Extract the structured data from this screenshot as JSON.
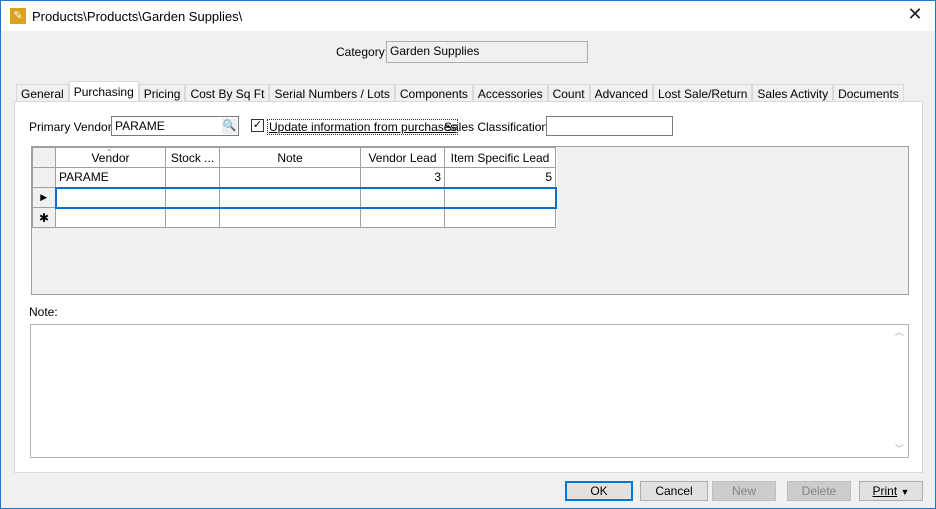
{
  "window": {
    "title": "Products\\Products\\Garden Supplies\\"
  },
  "category": {
    "label": "Category:",
    "value": "Garden Supplies"
  },
  "tabs": [
    "General",
    "Purchasing",
    "Pricing",
    "Cost By Sq Ft",
    "Serial Numbers / Lots",
    "Components",
    "Accessories",
    "Count",
    "Advanced",
    "Lost Sale/Return",
    "Sales Activity",
    "Documents"
  ],
  "active_tab": "Purchasing",
  "purchasing": {
    "primary_vendor_label": "Primary Vendor:",
    "primary_vendor_value": "PARAME",
    "update_checkbox_label": "Update information from purchases",
    "update_checked": true,
    "sales_class_label": "Sales Classification:",
    "sales_class_value": ""
  },
  "grid": {
    "columns": [
      "Vendor",
      "Stock ...",
      "Note",
      "Vendor Lead",
      "Item Specific Lead"
    ],
    "rows": [
      [
        "PARAME",
        "",
        "",
        "3",
        "5"
      ],
      [
        "",
        "",
        "",
        "",
        ""
      ],
      [
        "",
        "",
        "",
        "",
        ""
      ]
    ]
  },
  "note": {
    "label": "Note:",
    "value": ""
  },
  "buttons": {
    "ok": "OK",
    "cancel": "Cancel",
    "new": "New",
    "delete": "Delete",
    "print": "Print"
  }
}
